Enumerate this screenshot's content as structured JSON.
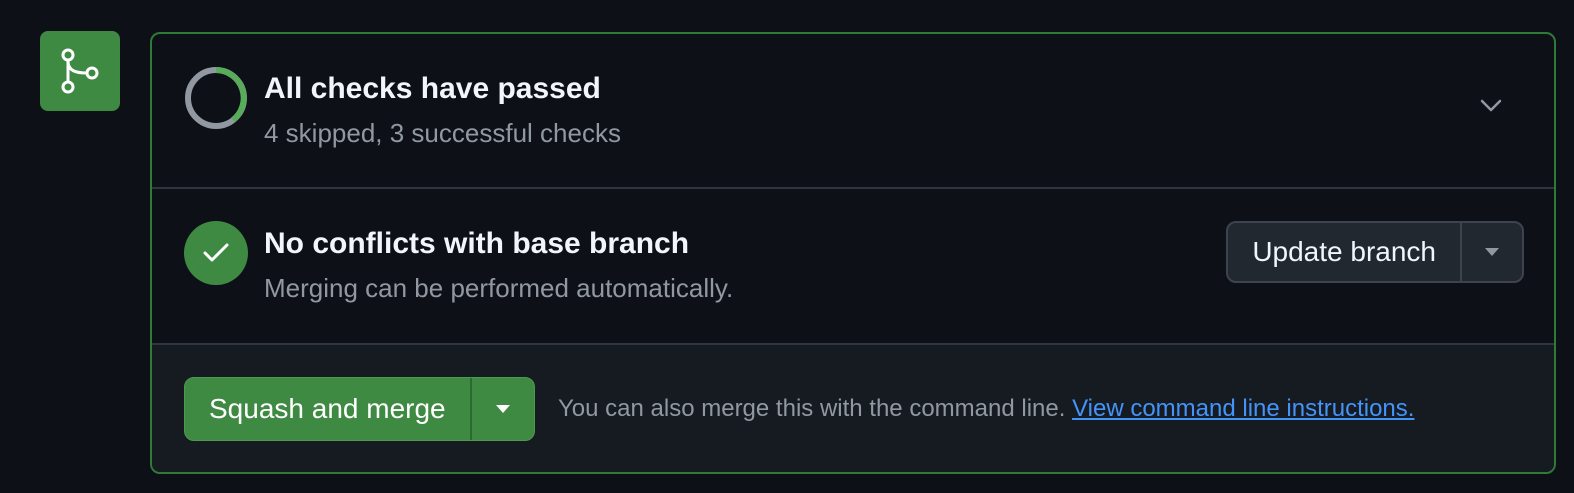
{
  "colors": {
    "success": "#3f8a43",
    "panel_border": "#2f7a38",
    "link": "#4493f8",
    "muted_text": "#9198a1"
  },
  "timeline": {
    "icon": "git-merge-icon"
  },
  "checks": {
    "icon": "checks-progress-ring-icon",
    "title": "All checks have passed",
    "subtitle": "4 skipped, 3 successful checks",
    "expand_icon": "chevron-down-icon"
  },
  "conflicts": {
    "icon": "check-circle-icon",
    "title": "No conflicts with base branch",
    "subtitle": "Merging can be performed automatically.",
    "update_button_label": "Update branch",
    "update_dropdown_icon": "triangle-down-icon"
  },
  "merge": {
    "button_label": "Squash and merge",
    "dropdown_icon": "triangle-down-icon",
    "hint_text": "You can also merge this with the command line.",
    "hint_link": "View command line instructions."
  }
}
